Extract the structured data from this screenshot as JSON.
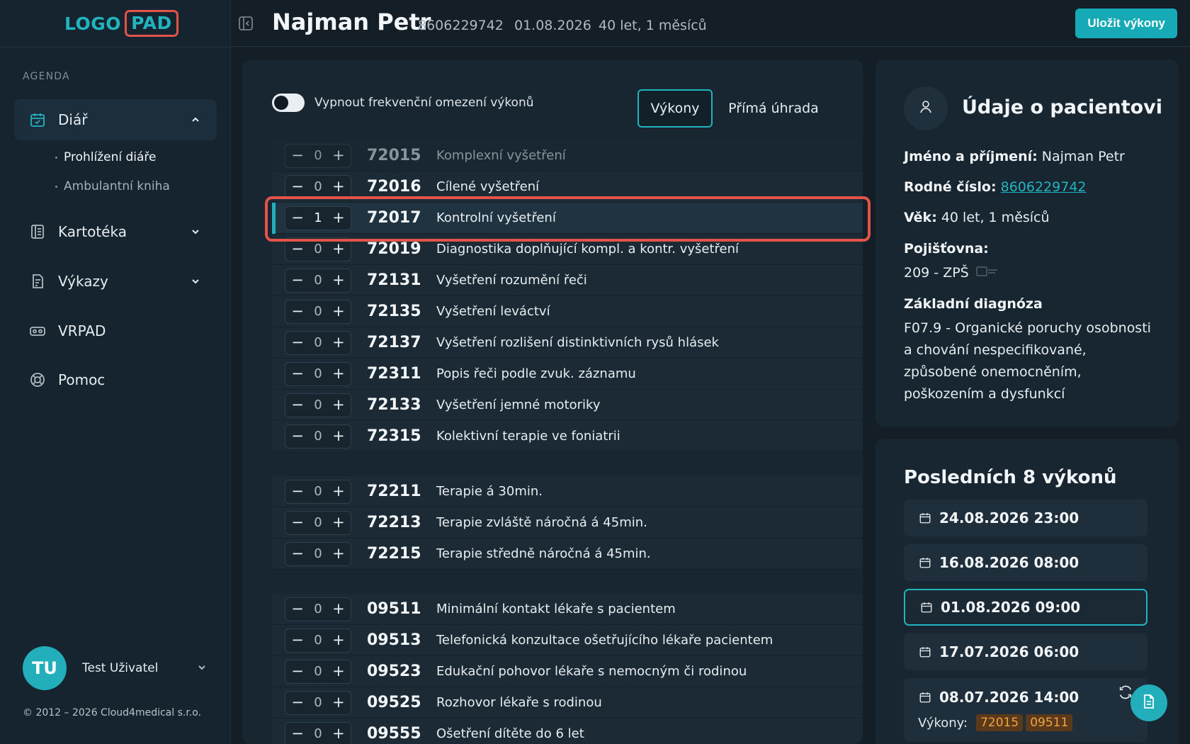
{
  "app": {
    "logo_part1": "LOGO",
    "logo_part2": "PAD"
  },
  "sidebar": {
    "section_label": "AGENDA",
    "items": [
      {
        "label": "Diář",
        "icon": "calendar-check-icon",
        "expanded": true
      },
      {
        "label": "Kartotéka",
        "icon": "cards-index-icon"
      },
      {
        "label": "Výkazy",
        "icon": "report-icon"
      },
      {
        "label": "VRPAD",
        "icon": "vr-headset-icon"
      },
      {
        "label": "Pomoc",
        "icon": "lifebuoy-icon"
      }
    ],
    "subitems": [
      {
        "label": "Prohlížení diáře",
        "active": true
      },
      {
        "label": "Ambulantní kniha",
        "active": false
      }
    ],
    "user": {
      "initials": "TU",
      "name": "Test Uživatel"
    },
    "copyright": "© 2012 – 2026 Cloud4medical s.r.o."
  },
  "header": {
    "patient_name": "Najman Petr",
    "birth_number": "8606229742",
    "date": "01.08.2026",
    "age": "40 let, 1 měsíců",
    "save_label": "Uložit výkony"
  },
  "main": {
    "toggle_label": "Vypnout frekvenční omezení výkonů",
    "toggle_on": false,
    "tabs": [
      {
        "label": "Výkony",
        "active": true
      },
      {
        "label": "Přímá úhrada",
        "active": false
      }
    ],
    "procedures": [
      {
        "qty": "0",
        "code": "72015",
        "name": "Komplexní vyšetření",
        "dim": true
      },
      {
        "qty": "0",
        "code": "72016",
        "name": "Cílené vyšetření"
      },
      {
        "qty": "1",
        "code": "72017",
        "name": "Kontrolní vyšetření",
        "selected": true
      },
      {
        "qty": "0",
        "code": "72019",
        "name": "Diagnostika doplňující kompl. a kontr. vyšetření"
      },
      {
        "qty": "0",
        "code": "72131",
        "name": "Vyšetření rozumění řeči"
      },
      {
        "qty": "0",
        "code": "72135",
        "name": "Vyšetření leváctví"
      },
      {
        "qty": "0",
        "code": "72137",
        "name": "Vyšetření rozlišení distinktivních rysů hlásek"
      },
      {
        "qty": "0",
        "code": "72311",
        "name": "Popis řeči podle zvuk. záznamu"
      },
      {
        "qty": "0",
        "code": "72133",
        "name": "Vyšetření jemné motoriky"
      },
      {
        "qty": "0",
        "code": "72315",
        "name": "Kolektivní terapie ve foniatrii"
      },
      {
        "qty": "0",
        "code": "72211",
        "name": "Terapie á 30min."
      },
      {
        "qty": "0",
        "code": "72213",
        "name": "Terapie zvláště náročná á 45min."
      },
      {
        "qty": "0",
        "code": "72215",
        "name": "Terapie středně náročná á 45min."
      },
      {
        "qty": "0",
        "code": "09511",
        "name": "Minimální kontakt lékaře s pacientem"
      },
      {
        "qty": "0",
        "code": "09513",
        "name": "Telefonická konzultace ošetřujícího lékaře pacientem"
      },
      {
        "qty": "0",
        "code": "09523",
        "name": "Edukační pohovor lékaře s nemocným či rodinou"
      },
      {
        "qty": "0",
        "code": "09525",
        "name": "Rozhovor lékaře s rodinou"
      },
      {
        "qty": "0",
        "code": "09555",
        "name": "Ošetření dítěte do 6 let"
      }
    ]
  },
  "patient": {
    "title": "Údaje o pacientovi",
    "name_label": "Jméno a příjmení:",
    "name": "Najman Petr",
    "rc_label": "Rodné číslo:",
    "rc": "8606229742",
    "age_label": "Věk:",
    "age": "40 let, 1 měsíců",
    "insurance_label": "Pojišťovna:",
    "insurance": "209 - ZPŠ",
    "diagnosis_label": "Základní diagnóza",
    "diagnosis": "F07.9 - Organické poruchy osobnosti a chování nespecifikované, způsobené onemocněním, poškozením a dysfunkcí"
  },
  "recent": {
    "title": "Posledních 8 výkonů",
    "items": [
      {
        "datetime": "24.08.2026 23:00"
      },
      {
        "datetime": "16.08.2026 08:00"
      },
      {
        "datetime": "01.08.2026 09:00",
        "active": true
      },
      {
        "datetime": "17.07.2026 06:00"
      },
      {
        "datetime": "08.07.2026 14:00",
        "procedures_label": "Výkony:",
        "codes": [
          "72015",
          "09511"
        ]
      }
    ]
  },
  "colors": {
    "accent": "#22b3c0",
    "highlight": "#e2534a",
    "tag_bg": "#5a3a1a",
    "tag_fg": "#f0a340"
  }
}
